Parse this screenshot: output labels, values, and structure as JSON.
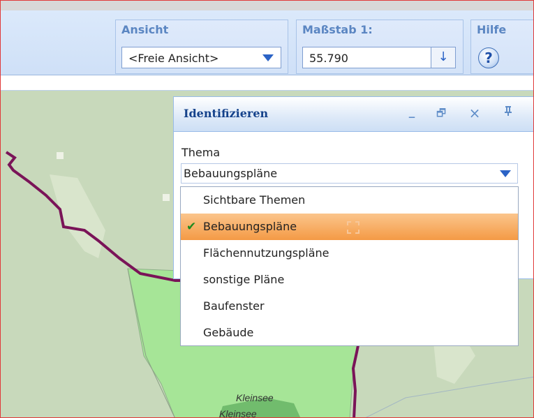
{
  "toolbar": {
    "ansicht": {
      "title": "Ansicht",
      "value": "<Freie Ansicht>",
      "arrow_icon": "triangle-down-icon"
    },
    "massstab": {
      "title": "Maßstab 1:",
      "value": "55.790",
      "arrow_icon": "down-arrow-icon",
      "arrow_glyph": "↓"
    },
    "hilfe": {
      "title": "Hilfe",
      "icon": "help-icon",
      "glyph": "?"
    }
  },
  "panel": {
    "title": "Identifizieren",
    "tools": {
      "minimize": "_",
      "restore": "🗗",
      "close": "×",
      "pin": "ꟷ"
    },
    "field_label": "Thema",
    "combo_value": "Bebauungspläne",
    "options": [
      {
        "label": "Sichtbare Themen",
        "selected": false
      },
      {
        "label": "Bebauungspläne",
        "selected": true
      },
      {
        "label": "Flächennutzungspläne",
        "selected": false
      },
      {
        "label": "sonstige Pläne",
        "selected": false
      },
      {
        "label": "Baufenster",
        "selected": false
      },
      {
        "label": "Gebäude",
        "selected": false
      }
    ],
    "check_glyph": "✔"
  },
  "map": {
    "labels": {
      "lake1": "Kleinsee",
      "lake2": "Kleinsee"
    },
    "colors": {
      "background": "#c8d9bb",
      "area": "#9fe08f",
      "boundary": "#7a1458",
      "lake": "#5fae5f"
    }
  },
  "colors": {
    "accent": "#2b63c6",
    "title_text": "#15428b",
    "selected_option": "#f49a45"
  }
}
